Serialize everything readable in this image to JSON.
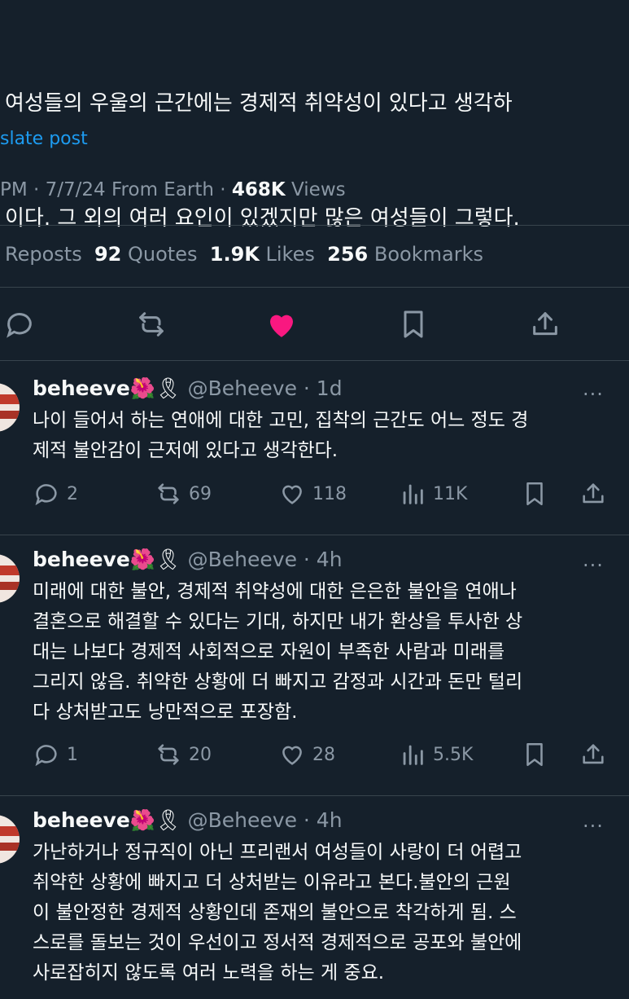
{
  "post": {
    "lines": [
      "여성들의 우울의 근간에는 경제적 취약성이 있다고 생각하",
      "이다. 그 외의 여러 요인이 있겠지만 많은 여성들이 그렇다."
    ],
    "translate": "slate post",
    "meta_prefix": "PM · 7/7/24 From Earth · ",
    "views_count": "468K",
    "views_label": " Views",
    "stats": {
      "reposts_label": "Reposts",
      "quotes_count": "92",
      "quotes_label": "Quotes",
      "likes_count": "1.9K",
      "likes_label": "Likes",
      "bookmarks_count": "256",
      "bookmarks_label": "Bookmarks"
    },
    "like_color": "#f91880"
  },
  "replies": [
    {
      "name": "beheeve",
      "emoji": "🌺🎗",
      "handle": "@Beheeve · 1d",
      "more": "···",
      "lines": [
        "나이 들어서 하는 연애에 대한 고민, 집착의 근간도 어느 정도 경",
        "제적 불안감이 근저에 있다고 생각한다."
      ],
      "replies": "2",
      "reposts": "69",
      "likes": "118",
      "views": "11K"
    },
    {
      "name": "beheeve",
      "emoji": "🌺🎗",
      "handle": "@Beheeve · 4h",
      "more": "···",
      "lines": [
        "미래에 대한 불안, 경제적 취약성에 대한 은은한 불안을 연애나",
        "결혼으로 해결할 수 있다는 기대, 하지만 내가 환상을 투사한 상",
        "대는 나보다 경제적 사회적으로 자원이 부족한 사람과 미래를",
        "그리지 않음. 취약한 상황에 더 빠지고 감정과 시간과 돈만 털리",
        "다 상처받고도 낭만적으로 포장함."
      ],
      "replies": "1",
      "reposts": "20",
      "likes": "28",
      "views": "5.5K"
    },
    {
      "name": "beheeve",
      "emoji": "🌺🎗",
      "handle": "@Beheeve · 4h",
      "more": "···",
      "lines": [
        "가난하거나 정규직이 아닌 프리랜서 여성들이 사랑이 더 어렵고",
        "취약한 상황에 빠지고 더 상처받는 이유라고 본다.불안의 근원",
        "이 불안정한 경제적 상황인데 존재의 불안으로 착각하게 됨. 스",
        "스로를 돌보는 것이 우선이고 정서적 경제적으로 공포와 불안에",
        "사로잡히지 않도록 여러 노력을 하는 게 중요."
      ]
    }
  ]
}
